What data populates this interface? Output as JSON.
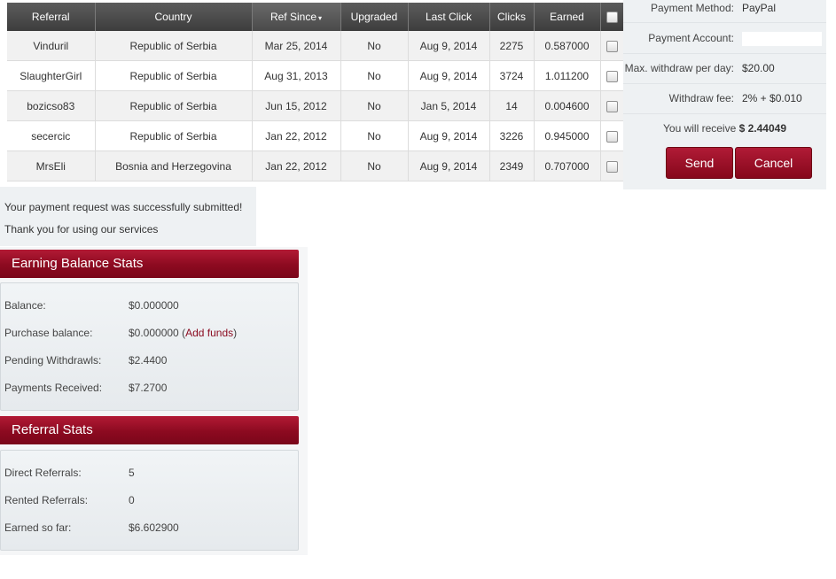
{
  "table": {
    "headers": [
      "Referral",
      "Country",
      "Ref Since",
      "Upgraded",
      "Last Click",
      "Clicks",
      "Earned"
    ],
    "sort_indicator": "▾",
    "rows": [
      {
        "referral": "Vinduril",
        "country": "Republic of Serbia",
        "ref_since": "Mar 25, 2014",
        "upgraded": "No",
        "last_click": "Aug 9, 2014",
        "clicks": "2275",
        "earned": "0.587000"
      },
      {
        "referral": "SlaughterGirl",
        "country": "Republic of Serbia",
        "ref_since": "Aug 31, 2013",
        "upgraded": "No",
        "last_click": "Aug 9, 2014",
        "clicks": "3724",
        "earned": "1.011200"
      },
      {
        "referral": "bozicso83",
        "country": "Republic of Serbia",
        "ref_since": "Jun 15, 2012",
        "upgraded": "No",
        "last_click": "Jan 5, 2014",
        "clicks": "14",
        "earned": "0.004600"
      },
      {
        "referral": "secercic",
        "country": "Republic of Serbia",
        "ref_since": "Jan 22, 2012",
        "upgraded": "No",
        "last_click": "Aug 9, 2014",
        "clicks": "3226",
        "earned": "0.945000"
      },
      {
        "referral": "MrsEli",
        "country": "Bosnia and Herzegovina",
        "ref_since": "Jan 22, 2012",
        "upgraded": "No",
        "last_click": "Aug 9, 2014",
        "clicks": "2349",
        "earned": "0.707000"
      }
    ]
  },
  "payment": {
    "method_label": "Payment Method:",
    "method_value": "PayPal",
    "account_label": "Payment Account:",
    "max_withdraw_label": "Max. withdraw per day:",
    "max_withdraw_value": "$20.00",
    "fee_label": "Withdraw fee:",
    "fee_value": "2% + $0.010",
    "receive_text": "You will receive",
    "receive_amount": "$ 2.44049",
    "send_label": "Send",
    "cancel_label": "Cancel"
  },
  "message": {
    "line1": "Your payment request was successfully submitted!",
    "line2": "Thank you for using our services"
  },
  "earning_stats": {
    "title": "Earning Balance Stats",
    "balance_label": "Balance:",
    "balance_value": "$0.000000",
    "purchase_label": "Purchase balance:",
    "purchase_value": "$0.000000",
    "add_funds_open": "(",
    "add_funds_label": "Add funds",
    "add_funds_close": ")",
    "pending_label": "Pending Withdrawls:",
    "pending_value": "$2.4400",
    "received_label": "Payments Received:",
    "received_value": "$7.2700"
  },
  "referral_stats": {
    "title": "Referral Stats",
    "direct_label": "Direct Referrals:",
    "direct_value": "5",
    "rented_label": "Rented Referrals:",
    "rented_value": "0",
    "earned_label": "Earned so far:",
    "earned_value": "$6.602900"
  }
}
